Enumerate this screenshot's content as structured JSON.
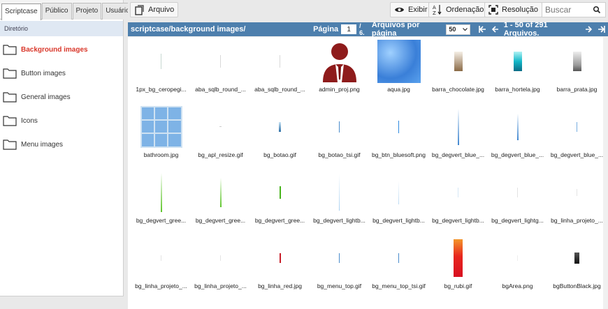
{
  "sidebar": {
    "tabs": [
      "Scriptcase",
      "Público",
      "Projeto",
      "Usuário"
    ],
    "header": "Diretório",
    "folders": [
      "Background images",
      "Button images",
      "General images",
      "Icons",
      "Menu images"
    ]
  },
  "toolbar": {
    "file_label": "Arquivo",
    "view_label": "Exibir",
    "sort_label": "Ordenação",
    "resolution_label": "Resolução",
    "search_placeholder": "Buscar"
  },
  "pathbar": {
    "path": "scriptcase/background images/",
    "page_label": "Página",
    "page_value": "1",
    "page_total": "/ 6.",
    "per_page_label": "Arquivos por página",
    "per_page_value": "50",
    "range": "1 - 50 of 291 Arquivos."
  },
  "files": [
    "1px_bg_ceropegi...",
    "aba_sqlb_round_...",
    "aba_sqlb_round_...",
    "admin_proj.png",
    "aqua.jpg",
    "barra_chocolate.jpg",
    "barra_hortela.jpg",
    "barra_prata.jpg",
    "bathroom.jpg",
    "bg_apl_resize.gif",
    "bg_botao.gif",
    "bg_botao_tsi.gif",
    "bg_btn_bluesoft.png",
    "bg_degvert_blue_...",
    "bg_degvert_blue_...",
    "bg_degvert_blue_...",
    "bg_degvert_gree...",
    "bg_degvert_gree...",
    "bg_degvert_gree...",
    "bg_degvert_lightb...",
    "bg_degvert_lightb...",
    "bg_degvert_lightb...",
    "bg_degvert_lightg...",
    "bg_linha_projeto_...",
    "bg_linha_projeto_...",
    "bg_linha_projeto_...",
    "bg_linha_red.jpg",
    "bg_menu_top.gif",
    "bg_menu_top_tsi.gif",
    "bg_rubi.gif",
    "bgArea.png",
    "bgButtonBlack.jpg"
  ],
  "colors": {
    "accent": "#4d7fad",
    "active_folder": "#d9372a"
  }
}
